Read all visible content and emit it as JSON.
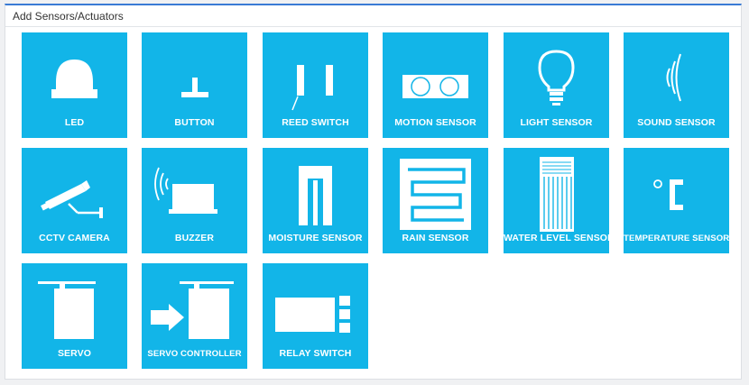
{
  "panel": {
    "title": "Add Sensors/Actuators"
  },
  "tiles": [
    {
      "label": "LED",
      "icon": "led-icon"
    },
    {
      "label": "BUTTON",
      "icon": "button-icon"
    },
    {
      "label": "REED SWITCH",
      "icon": "reed-switch-icon"
    },
    {
      "label": "MOTION SENSOR",
      "icon": "motion-sensor-icon"
    },
    {
      "label": "LIGHT SENSOR",
      "icon": "light-bulb-icon"
    },
    {
      "label": "SOUND SENSOR",
      "icon": "sound-waves-icon"
    },
    {
      "label": "CCTV CAMERA",
      "icon": "cctv-camera-icon"
    },
    {
      "label": "BUZZER",
      "icon": "buzzer-icon"
    },
    {
      "label": "MOISTURE SENSOR",
      "icon": "moisture-sensor-icon"
    },
    {
      "label": "RAIN SENSOR",
      "icon": "rain-sensor-icon"
    },
    {
      "label": "WATER LEVEL SENSOR",
      "icon": "water-level-sensor-icon"
    },
    {
      "label": "TEMPERATURE SENSOR",
      "icon": "celsius-icon"
    },
    {
      "label": "SERVO",
      "icon": "servo-icon"
    },
    {
      "label": "SERVO CONTROLLER",
      "icon": "servo-controller-icon"
    },
    {
      "label": "RELAY SWITCH",
      "icon": "relay-switch-icon"
    }
  ],
  "colors": {
    "tile": "#12b5e8",
    "accent": "#3a7bd5",
    "icon": "#ffffff"
  }
}
